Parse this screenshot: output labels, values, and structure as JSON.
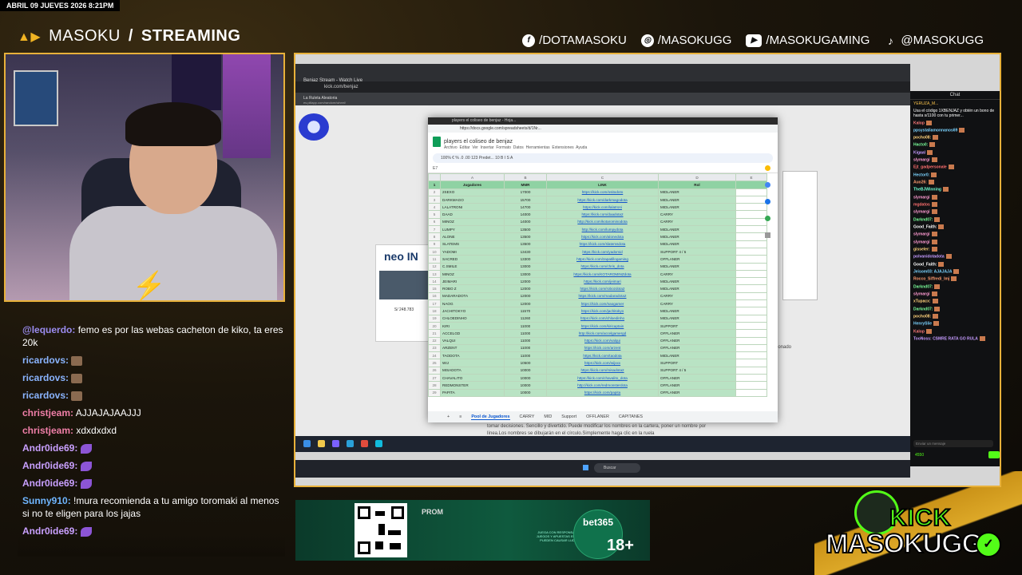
{
  "datebar": "ABRIL 09 JUEVES 2026 8:21PM",
  "brand": {
    "left": "MASOKU",
    "sep": "/",
    "right": "STREAMING"
  },
  "socials": [
    {
      "icon": "facebook-icon",
      "text": "/DOTAMASOKU"
    },
    {
      "icon": "instagram-icon",
      "text": "/MASOKUGG"
    },
    {
      "icon": "youtube-icon",
      "text": "/MASOKUGAMING"
    },
    {
      "icon": "tiktok-icon",
      "text": "@MASOKUGG"
    }
  ],
  "chat": [
    {
      "user": "@lequerdo:",
      "msg": "femo es por las webas cacheton de kiko, ta eres 20k",
      "color": "#9b8cf0"
    },
    {
      "user": "ricardovs:",
      "msg": "",
      "color": "#8ab4ff",
      "emote": "face"
    },
    {
      "user": "ricardovs:",
      "msg": "",
      "color": "#8ab4ff",
      "emote": "face"
    },
    {
      "user": "ricardovs:",
      "msg": "",
      "color": "#8ab4ff",
      "emote": "face"
    },
    {
      "user": "christjeam:",
      "msg": "AJJAJAJAAJJJ",
      "color": "#f07fa8"
    },
    {
      "user": "christjeam:",
      "msg": "xdxdxdxd",
      "color": "#f07fa8"
    },
    {
      "user": "Andr0ide69:",
      "msg": "",
      "color": "#c9a0ff",
      "emote": "purple"
    },
    {
      "user": "Andr0ide69:",
      "msg": "",
      "color": "#c9a0ff",
      "emote": "purple"
    },
    {
      "user": "Andr0ide69:",
      "msg": "",
      "color": "#c9a0ff",
      "emote": "purple"
    },
    {
      "user": "Sunny910:",
      "msg": "!mura recomienda a tu amigo toromaki al menos si no te eligen para los jajas",
      "color": "#6fb6ff"
    },
    {
      "user": "Andr0ide69:",
      "msg": "",
      "color": "#c9a0ff",
      "emote": "purple"
    }
  ],
  "browser": {
    "tab": "Benjaz Stream - Watch Live",
    "url": "kick.com/benjaz",
    "inner_tab": "La Ruleta Aleatoria",
    "inner_url": "es.piliapp.com/random/wheel/",
    "neo_text": "neo IN",
    "neo_price": "S/ 248.783",
    "side_text": "cionado",
    "desc": "tomar decisiones. Sencillo y divertido. Puede modificar los nombres en la cartera, poner un nombre por línea.Los nombres se dibujarán en el círculo.Simplemente haga clic en la ruela",
    "taskbar_search": "Buscar"
  },
  "sheet": {
    "window_title": "players el coliseo de benjaz - Hoja...",
    "url": "https://docs.google.com/spreadsheets/d/1Nr...",
    "title": "players el coliseo de benjaz",
    "menu": [
      "Archivo",
      "Editar",
      "Ver",
      "Insertar",
      "Formato",
      "Datos",
      "Herramientas",
      "Extensiones",
      "Ayuda"
    ],
    "toolbar": "100%  €  %  .0  .00  123  Predet...  10  B  I  S  A",
    "cell_ref": "E7",
    "col_letters": [
      "A",
      "B",
      "C",
      "D",
      "E"
    ],
    "headers": [
      "Jugadores",
      "MMR",
      "LINK",
      "Rol"
    ],
    "rows": [
      [
        "2SEXO",
        "17000",
        "https://kick.com/ositodoto",
        "MIDLANER"
      ],
      [
        "DARKMAGO",
        "15700",
        "https://kick.com/darkmagodota",
        "MIDLANER"
      ],
      [
        "LALATRONI",
        "14700",
        "https://kick.com/lalatroni",
        "MIDLANER"
      ],
      [
        "DAAD",
        "14000",
        "https://kick.com/daadota2",
        "CARRY"
      ],
      [
        "MINOZ",
        "14000",
        "http://kick.com/kotarominodota",
        "CARRY"
      ],
      [
        "LUMPY",
        "13500",
        "http://kick.com/lumpydota",
        "MIDLANER"
      ],
      [
        "ALONE",
        "13500",
        "https://kick.com/alonedota",
        "MIDLANER"
      ],
      [
        "SLATEMS",
        "13500",
        "https://kick.com/slatemsdota",
        "MIDLANER"
      ],
      [
        "YADOMI",
        "13430",
        "https://kick.com/yadomid",
        "SUPPORT 4 / 5"
      ],
      [
        "SACRED",
        "13300",
        "https://kick.com/zapatillogaming",
        "OFFLANER"
      ],
      [
        "C.SMILE",
        "13000",
        "https://kick.com/chris_dota",
        "MIDLANER"
      ],
      [
        "MINOZ",
        "13000",
        "https://kick.com/KOTAROMINZdota",
        "CARRY"
      ],
      [
        "JEIMARI",
        "12000",
        "https://kick.com/jeimari",
        "MIDLANER"
      ],
      [
        "ROBO Z",
        "12000",
        "https://kick.com/robozdota2",
        "MIDLANER"
      ],
      [
        "MADARADOTA",
        "12000",
        "https://kick.com/madaradota2",
        "CARRY"
      ],
      [
        "NAOG",
        "12000",
        "https://kick.com/naogamer",
        "CARRY"
      ],
      [
        "JACHITOKYO",
        "11570",
        "https://kick.com/jachitokyo",
        "MIDLANER"
      ],
      [
        "CHLOEDINHO",
        "11260",
        "https://kick.com/chloedinho",
        "MIDLANER"
      ],
      [
        "KIRI",
        "11000",
        "https://kick.com/kiricaptain",
        "SUPPORT"
      ],
      [
        "ACCELGD",
        "11000",
        "http://kick.com/accelgamergd",
        "OFFLANER"
      ],
      [
        "VALQUI",
        "11000",
        "https://kick.com/valqui",
        "OFFLANER"
      ],
      [
        "ARZENT",
        "11000",
        "https://kick.com/arzent",
        "OFFLANER"
      ],
      [
        "TAODOTA",
        "11000",
        "https://kick.com/taodota",
        "MIDLANER"
      ],
      [
        "WIJ",
        "10500",
        "https://kick.com/wijxxx",
        "SUPPORT"
      ],
      [
        "MISADOTA",
        "10000",
        "https://kick.com/misadota2",
        "SUPPORT 4 / 5"
      ],
      [
        "CHAVALITO",
        "10000",
        "https://kick.com/chavalito_dota",
        "OFFLANER"
      ],
      [
        "REDMONSTER",
        "10000",
        "http://kick.com/redmonsterdota",
        "OFFLANER"
      ],
      [
        "PAPITA",
        "10000",
        "https://kick.com/papita",
        "OFFLANER"
      ]
    ],
    "tabs": [
      "Pool de Jugadores",
      "CARRY",
      "MID",
      "Support",
      "OFFLANER",
      "CAPITANES"
    ]
  },
  "kick_chat": {
    "header": "Chat",
    "pinned_top": "YERUZA_M...",
    "promo": "Usa el código 1XBENJAZ y obtén un bono de hasta s/1100 con tu primer...",
    "lines": [
      {
        "user": "Kalop",
        "color": "#ff7b7b"
      },
      {
        "user": "ppsystaliamonnanos69",
        "color": "#7bd3ff"
      },
      {
        "user": "pocho08:",
        "color": "#ffd27b"
      },
      {
        "user": "Hacto0:",
        "color": "#7bff9a"
      },
      {
        "user": "Kigaal",
        "color": "#c59bff"
      },
      {
        "user": "slymargi",
        "color": "#ff9bd2"
      },
      {
        "user": "Ejt_gadpersonale",
        "color": "#ff6f6f"
      },
      {
        "user": "Hector0:",
        "color": "#7bd3ff"
      },
      {
        "user": "Auo26:",
        "color": "#ff9b6f"
      },
      {
        "user": "TheBJWinning",
        "color": "#6fffd2"
      },
      {
        "user": "slymargi",
        "color": "#ff9bd2"
      },
      {
        "user": "mgdatos",
        "color": "#ff6f6f"
      },
      {
        "user": "slymargi",
        "color": "#ff9bd2"
      },
      {
        "user": "Darknd07:",
        "color": "#7bff9a"
      },
      {
        "user": "Good_Faith:",
        "color": "#ffffff"
      },
      {
        "user": "slymargi",
        "color": "#ff9bd2"
      },
      {
        "user": "slymargi",
        "color": "#ff9bd2"
      },
      {
        "user": "gisseler:",
        "color": "#ffd27b"
      },
      {
        "user": "polvanidotadota",
        "color": "#c59bff"
      },
      {
        "user": "Good_Faith:",
        "color": "#ffffff"
      },
      {
        "user": "Jeisom03: AJAJAJA",
        "color": "#7bd3ff"
      },
      {
        "user": "Rocco_Siffredi_lmj",
        "color": "#ff9b6f"
      },
      {
        "user": "Darknd07:",
        "color": "#7bff9a"
      },
      {
        "user": "slymargi",
        "color": "#ff9bd2"
      },
      {
        "user": "xTupacx:",
        "color": "#ffd27b"
      },
      {
        "user": "Darknd07:",
        "color": "#7bff9a"
      },
      {
        "user": "pocho08:",
        "color": "#ffd27b"
      },
      {
        "user": "HenrySlie",
        "color": "#7bd3ff"
      },
      {
        "user": "Kalop",
        "color": "#ff7b7b"
      },
      {
        "user": "TooNoss: CSMRE RATA GO RULA",
        "color": "#c59bff"
      }
    ],
    "input_placeholder": "Enviar un mensaje",
    "viewers": "4550"
  },
  "banner": {
    "prom": "PROM",
    "bet365": "bet365",
    "age": "18+",
    "legal": "JUEGA CON RESPONSABILIDAD. JUEGOS Y APUESTAS EN EXCESO PUEDEN CAUSAR LUDOPATÍA"
  },
  "kick_logo": {
    "kick": "KICK",
    "name": "MASOKUGG",
    "check": "✓"
  },
  "cam_overlay": {
    "logo": "⚡"
  }
}
